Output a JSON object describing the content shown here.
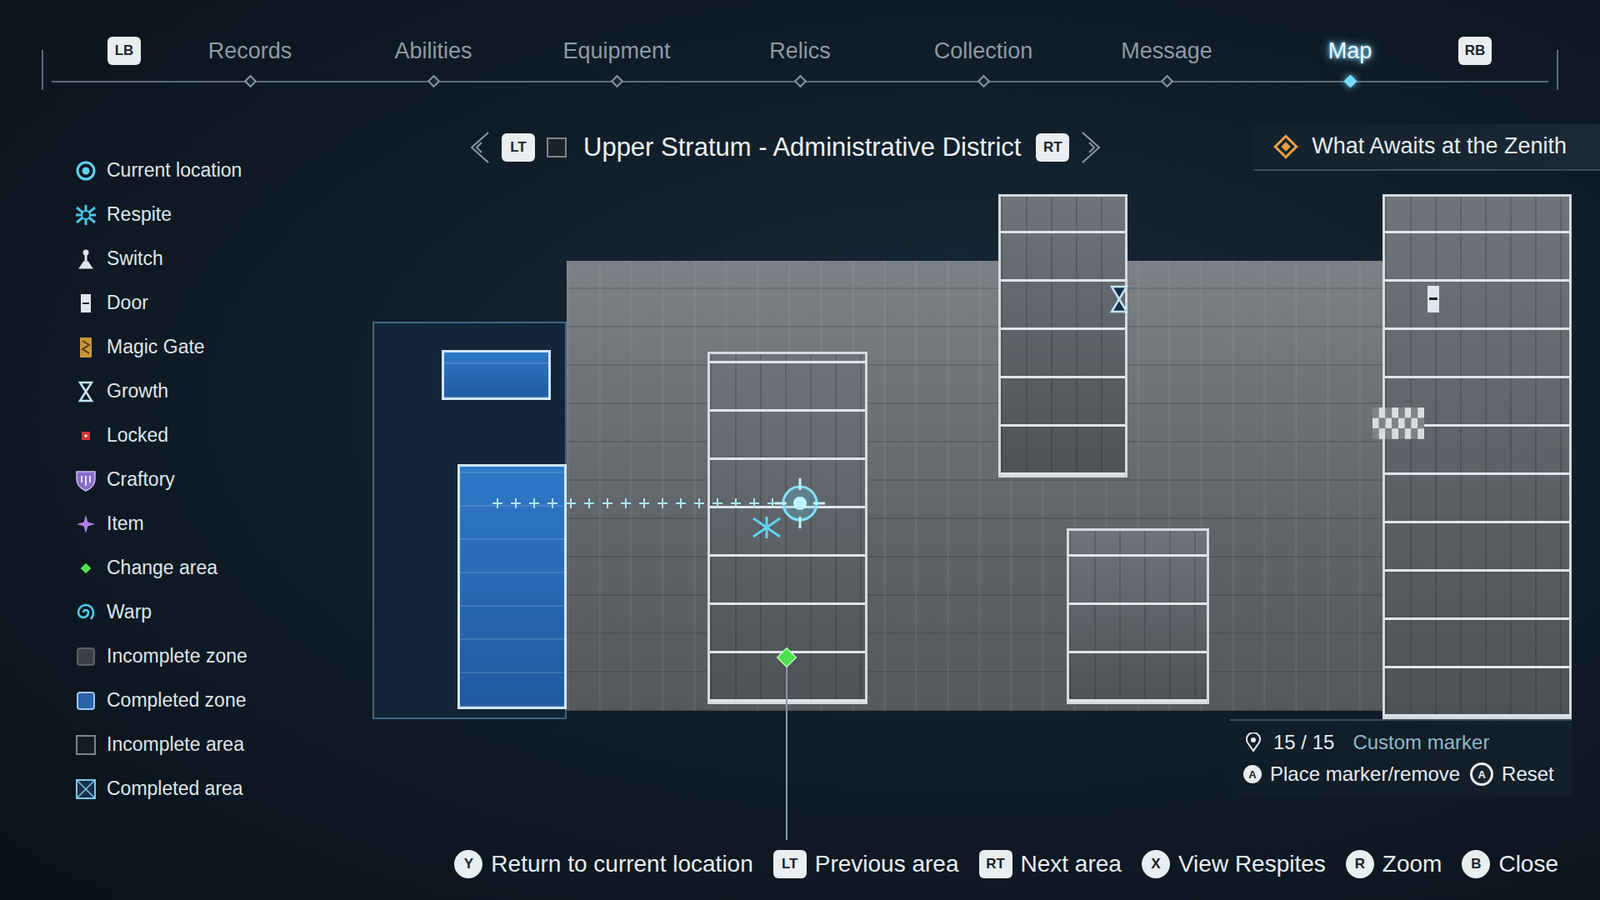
{
  "nav": {
    "left_key": "LB",
    "right_key": "RB",
    "tabs": [
      {
        "label": "Records",
        "selected": false
      },
      {
        "label": "Abilities",
        "selected": false
      },
      {
        "label": "Equipment",
        "selected": false
      },
      {
        "label": "Relics",
        "selected": false
      },
      {
        "label": "Collection",
        "selected": false
      },
      {
        "label": "Message",
        "selected": false
      },
      {
        "label": "Map",
        "selected": true
      }
    ]
  },
  "legend": [
    {
      "kind": "current-location",
      "label": "Current location"
    },
    {
      "kind": "respite",
      "label": "Respite"
    },
    {
      "kind": "switch",
      "label": "Switch"
    },
    {
      "kind": "door",
      "label": "Door"
    },
    {
      "kind": "magic-gate",
      "label": "Magic Gate"
    },
    {
      "kind": "growth",
      "label": "Growth"
    },
    {
      "kind": "locked",
      "label": "Locked"
    },
    {
      "kind": "craftory",
      "label": "Craftory"
    },
    {
      "kind": "item",
      "label": "Item"
    },
    {
      "kind": "change-area",
      "label": "Change area"
    },
    {
      "kind": "warp",
      "label": "Warp"
    },
    {
      "kind": "incomplete-zone",
      "label": "Incomplete zone"
    },
    {
      "kind": "completed-zone",
      "label": "Completed zone"
    },
    {
      "kind": "incomplete-area",
      "label": "Incomplete area"
    },
    {
      "kind": "completed-area",
      "label": "Completed area"
    }
  ],
  "map": {
    "title": "Upper Stratum - Administrative District",
    "prev_key": "LT",
    "next_key": "RT",
    "zones": [
      {
        "completed": true
      },
      {
        "completed": true
      },
      {
        "completed": false
      },
      {
        "completed": false
      },
      {
        "completed": false
      },
      {
        "completed": false
      }
    ]
  },
  "quest": {
    "title": "What Awaits at the Zenith"
  },
  "markers": {
    "count": "15 / 15",
    "label": "Custom marker",
    "actions": [
      {
        "key": "A",
        "label": "Place marker/remove"
      },
      {
        "key": "A",
        "label": "Reset"
      }
    ]
  },
  "controls": [
    {
      "key": "Y",
      "label": "Return to current location"
    },
    {
      "key": "LT",
      "label": "Previous area"
    },
    {
      "key": "RT",
      "label": "Next area"
    },
    {
      "key": "X",
      "label": "View Respites"
    },
    {
      "key": "R",
      "label": "Zoom"
    },
    {
      "key": "B",
      "label": "Close"
    }
  ]
}
